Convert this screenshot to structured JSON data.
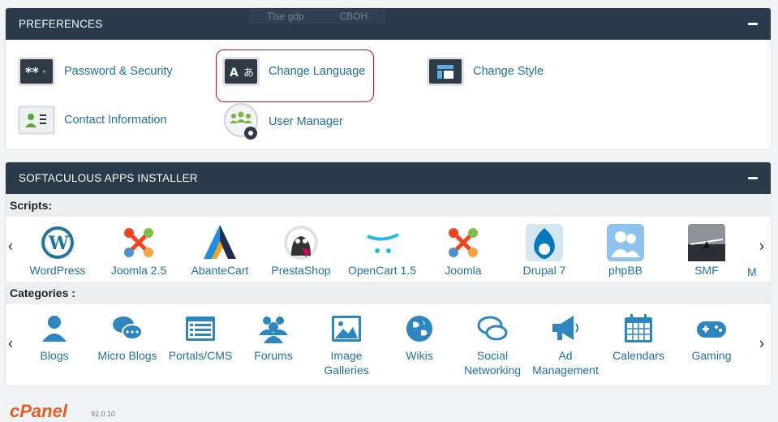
{
  "preferences": {
    "title": "PREFERENCES",
    "items": [
      {
        "label": "Password & Security",
        "icon": "password-icon"
      },
      {
        "label": "Change Language",
        "icon": "language-icon"
      },
      {
        "label": "Change Style",
        "icon": "style-icon"
      },
      {
        "label": "Contact Information",
        "icon": "contact-icon"
      },
      {
        "label": "User Manager",
        "icon": "user-manager-icon"
      }
    ]
  },
  "toolbar_ghost": {
    "left": "Tlse gdp",
    "right": "CBOH"
  },
  "softaculous": {
    "title": "SOFTACULOUS APPS INSTALLER",
    "scripts_label": "Scripts:",
    "categories_label": "Categories :",
    "scripts": [
      {
        "label": "WordPress",
        "icon": "wordpress-icon"
      },
      {
        "label": "Joomla 2.5",
        "icon": "joomla-icon"
      },
      {
        "label": "AbanteCart",
        "icon": "abantecart-icon"
      },
      {
        "label": "PrestaShop",
        "icon": "prestashop-icon"
      },
      {
        "label": "OpenCart 1.5",
        "icon": "opencart-icon"
      },
      {
        "label": "Joomla",
        "icon": "joomla-icon"
      },
      {
        "label": "Drupal 7",
        "icon": "drupal-icon"
      },
      {
        "label": "phpBB",
        "icon": "phpbb-icon"
      },
      {
        "label": "SMF",
        "icon": "smf-icon"
      },
      {
        "label": "M",
        "icon": "partial-icon"
      }
    ],
    "categories": [
      {
        "label": "Blogs",
        "icon": "blog-icon"
      },
      {
        "label": "Micro Blogs",
        "icon": "micro-blog-icon"
      },
      {
        "label": "Portals/CMS",
        "icon": "portal-icon"
      },
      {
        "label": "Forums",
        "icon": "forums-icon"
      },
      {
        "label": "Image Galleries",
        "icon": "image-gallery-icon"
      },
      {
        "label": "Wikis",
        "icon": "wiki-icon"
      },
      {
        "label": "Social Networking",
        "icon": "social-icon"
      },
      {
        "label": "Ad Management",
        "icon": "ad-icon"
      },
      {
        "label": "Calendars",
        "icon": "calendar-icon"
      },
      {
        "label": "Gaming",
        "icon": "gaming-icon"
      }
    ],
    "prev_arrow": "‹",
    "next_arrow": "›"
  },
  "footer": {
    "logo": "cPanel",
    "version": "92.0.10"
  },
  "colors": {
    "header": "#293a4a",
    "link": "#1f6fa8",
    "accent": "#e65c22",
    "annotation": "#d20f20"
  }
}
